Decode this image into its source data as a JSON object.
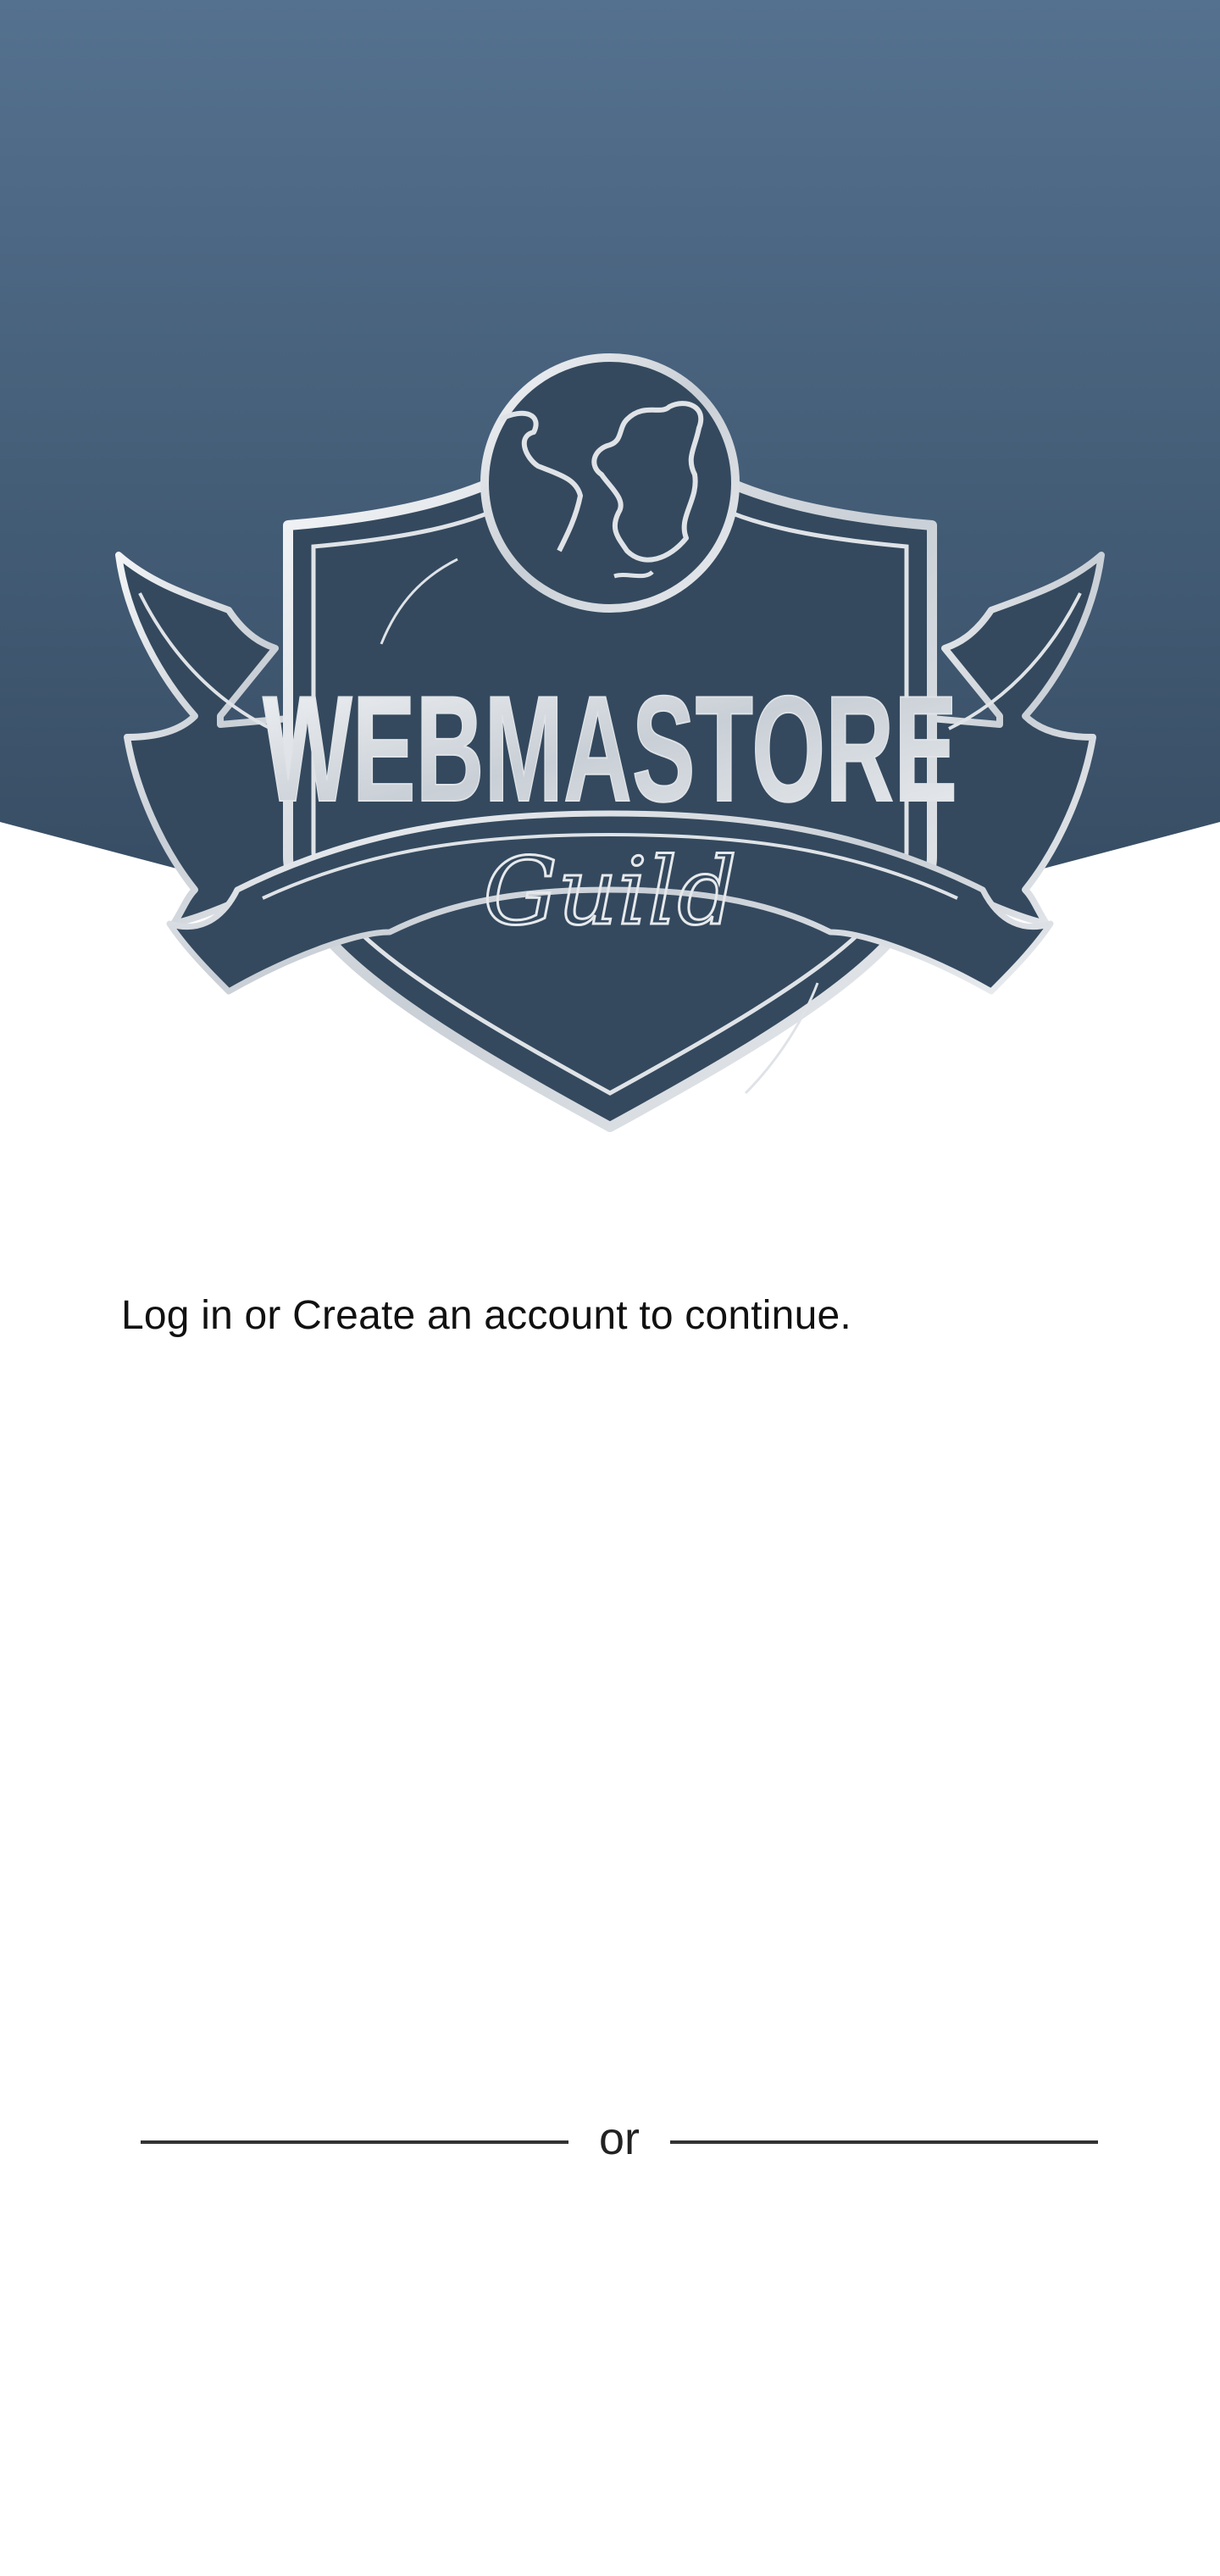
{
  "colors": {
    "header_top": "#53708f",
    "header_bottom": "#35495f",
    "logo_fill": "#34495e",
    "logo_silver": "#dfe3e7",
    "background": "#ffffff",
    "text": "#111111",
    "divider": "#333333"
  },
  "logo": {
    "brand_name": "WEBMASTORE",
    "subtitle": "Guild",
    "icons": [
      "globe-icon",
      "shield-crest-icon",
      "wing-left-icon",
      "wing-right-icon",
      "banner-ribbon-icon"
    ]
  },
  "auth": {
    "prompt": "Log in or Create an account to continue.",
    "divider_label": "or"
  }
}
